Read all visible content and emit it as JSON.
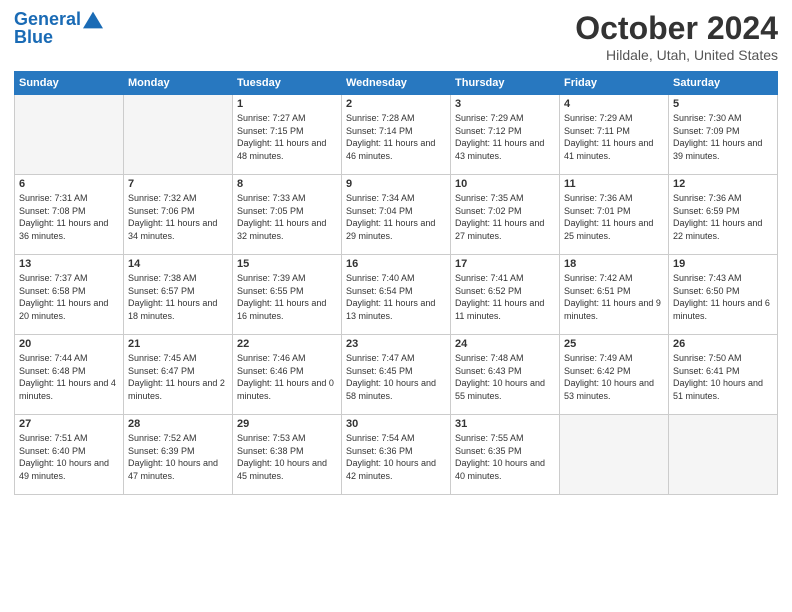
{
  "header": {
    "logo_line1": "General",
    "logo_line2": "Blue",
    "month": "October 2024",
    "location": "Hildale, Utah, United States"
  },
  "days_of_week": [
    "Sunday",
    "Monday",
    "Tuesday",
    "Wednesday",
    "Thursday",
    "Friday",
    "Saturday"
  ],
  "weeks": [
    [
      {
        "day": "",
        "empty": true
      },
      {
        "day": "",
        "empty": true
      },
      {
        "day": "1",
        "sunrise": "7:27 AM",
        "sunset": "7:15 PM",
        "daylight": "11 hours and 48 minutes."
      },
      {
        "day": "2",
        "sunrise": "7:28 AM",
        "sunset": "7:14 PM",
        "daylight": "11 hours and 46 minutes."
      },
      {
        "day": "3",
        "sunrise": "7:29 AM",
        "sunset": "7:12 PM",
        "daylight": "11 hours and 43 minutes."
      },
      {
        "day": "4",
        "sunrise": "7:29 AM",
        "sunset": "7:11 PM",
        "daylight": "11 hours and 41 minutes."
      },
      {
        "day": "5",
        "sunrise": "7:30 AM",
        "sunset": "7:09 PM",
        "daylight": "11 hours and 39 minutes."
      }
    ],
    [
      {
        "day": "6",
        "sunrise": "7:31 AM",
        "sunset": "7:08 PM",
        "daylight": "11 hours and 36 minutes."
      },
      {
        "day": "7",
        "sunrise": "7:32 AM",
        "sunset": "7:06 PM",
        "daylight": "11 hours and 34 minutes."
      },
      {
        "day": "8",
        "sunrise": "7:33 AM",
        "sunset": "7:05 PM",
        "daylight": "11 hours and 32 minutes."
      },
      {
        "day": "9",
        "sunrise": "7:34 AM",
        "sunset": "7:04 PM",
        "daylight": "11 hours and 29 minutes."
      },
      {
        "day": "10",
        "sunrise": "7:35 AM",
        "sunset": "7:02 PM",
        "daylight": "11 hours and 27 minutes."
      },
      {
        "day": "11",
        "sunrise": "7:36 AM",
        "sunset": "7:01 PM",
        "daylight": "11 hours and 25 minutes."
      },
      {
        "day": "12",
        "sunrise": "7:36 AM",
        "sunset": "6:59 PM",
        "daylight": "11 hours and 22 minutes."
      }
    ],
    [
      {
        "day": "13",
        "sunrise": "7:37 AM",
        "sunset": "6:58 PM",
        "daylight": "11 hours and 20 minutes."
      },
      {
        "day": "14",
        "sunrise": "7:38 AM",
        "sunset": "6:57 PM",
        "daylight": "11 hours and 18 minutes."
      },
      {
        "day": "15",
        "sunrise": "7:39 AM",
        "sunset": "6:55 PM",
        "daylight": "11 hours and 16 minutes."
      },
      {
        "day": "16",
        "sunrise": "7:40 AM",
        "sunset": "6:54 PM",
        "daylight": "11 hours and 13 minutes."
      },
      {
        "day": "17",
        "sunrise": "7:41 AM",
        "sunset": "6:52 PM",
        "daylight": "11 hours and 11 minutes."
      },
      {
        "day": "18",
        "sunrise": "7:42 AM",
        "sunset": "6:51 PM",
        "daylight": "11 hours and 9 minutes."
      },
      {
        "day": "19",
        "sunrise": "7:43 AM",
        "sunset": "6:50 PM",
        "daylight": "11 hours and 6 minutes."
      }
    ],
    [
      {
        "day": "20",
        "sunrise": "7:44 AM",
        "sunset": "6:48 PM",
        "daylight": "11 hours and 4 minutes."
      },
      {
        "day": "21",
        "sunrise": "7:45 AM",
        "sunset": "6:47 PM",
        "daylight": "11 hours and 2 minutes."
      },
      {
        "day": "22",
        "sunrise": "7:46 AM",
        "sunset": "6:46 PM",
        "daylight": "11 hours and 0 minutes."
      },
      {
        "day": "23",
        "sunrise": "7:47 AM",
        "sunset": "6:45 PM",
        "daylight": "10 hours and 58 minutes."
      },
      {
        "day": "24",
        "sunrise": "7:48 AM",
        "sunset": "6:43 PM",
        "daylight": "10 hours and 55 minutes."
      },
      {
        "day": "25",
        "sunrise": "7:49 AM",
        "sunset": "6:42 PM",
        "daylight": "10 hours and 53 minutes."
      },
      {
        "day": "26",
        "sunrise": "7:50 AM",
        "sunset": "6:41 PM",
        "daylight": "10 hours and 51 minutes."
      }
    ],
    [
      {
        "day": "27",
        "sunrise": "7:51 AM",
        "sunset": "6:40 PM",
        "daylight": "10 hours and 49 minutes."
      },
      {
        "day": "28",
        "sunrise": "7:52 AM",
        "sunset": "6:39 PM",
        "daylight": "10 hours and 47 minutes."
      },
      {
        "day": "29",
        "sunrise": "7:53 AM",
        "sunset": "6:38 PM",
        "daylight": "10 hours and 45 minutes."
      },
      {
        "day": "30",
        "sunrise": "7:54 AM",
        "sunset": "6:36 PM",
        "daylight": "10 hours and 42 minutes."
      },
      {
        "day": "31",
        "sunrise": "7:55 AM",
        "sunset": "6:35 PM",
        "daylight": "10 hours and 40 minutes."
      },
      {
        "day": "",
        "empty": true
      },
      {
        "day": "",
        "empty": true
      }
    ]
  ]
}
